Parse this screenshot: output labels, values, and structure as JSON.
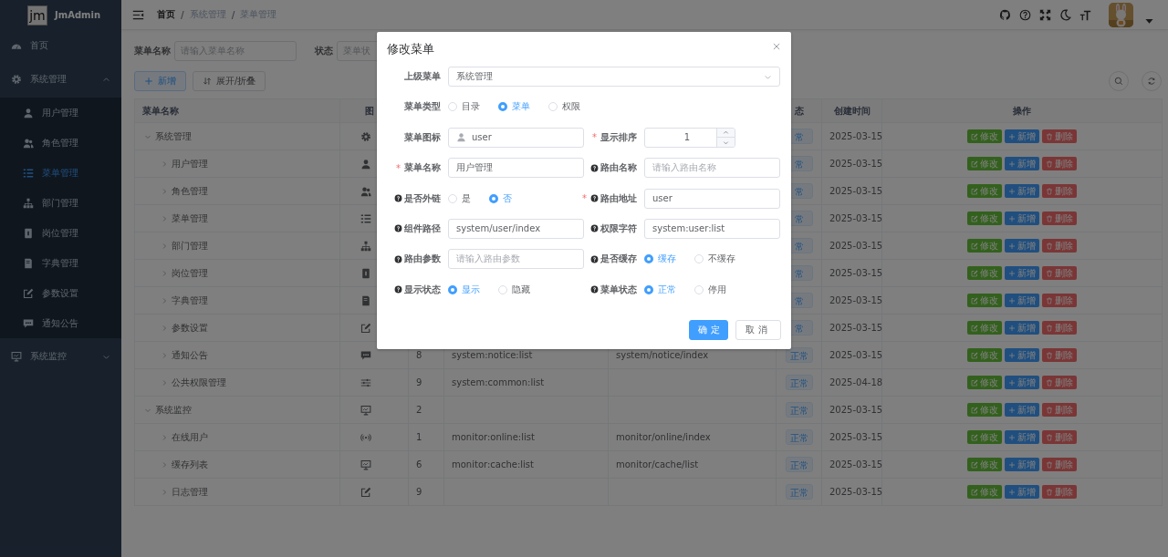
{
  "sidebar": {
    "brand": {
      "logo_text": "jm",
      "title": "JmAdmin"
    },
    "items": [
      {
        "kind": "link",
        "label": "首页",
        "selected": false
      },
      {
        "kind": "group",
        "label": "系统管理",
        "selected": false,
        "expanded": true,
        "children": [
          {
            "label": "用户管理",
            "selected": false
          },
          {
            "label": "角色管理",
            "selected": false
          },
          {
            "label": "菜单管理",
            "selected": true
          },
          {
            "label": "部门管理",
            "selected": false
          },
          {
            "label": "岗位管理",
            "selected": false
          },
          {
            "label": "字典管理",
            "selected": false
          },
          {
            "label": "参数设置",
            "selected": false
          },
          {
            "label": "通知公告",
            "selected": false
          }
        ]
      },
      {
        "kind": "group",
        "label": "系统监控",
        "selected": false,
        "expanded": false
      }
    ]
  },
  "header": {
    "breadcrumb": [
      {
        "kind": "link",
        "text": "首页"
      },
      {
        "kind": "separator",
        "text": "/"
      },
      {
        "kind": "text",
        "text": "系统管理"
      },
      {
        "kind": "separator",
        "text": "/"
      },
      {
        "kind": "text",
        "text": "菜单管理"
      }
    ]
  },
  "search_form": {
    "fields": [
      {
        "label": "菜单名称",
        "placeholder": "请输入菜单名称"
      },
      {
        "label": "状态",
        "placeholder": "菜单状"
      }
    ]
  },
  "toolbar": {
    "buttons": [
      {
        "kind": "primary",
        "label": "新增"
      },
      {
        "kind": "default",
        "label": "展开/折叠"
      }
    ]
  },
  "table": {
    "columns": {
      "menu_name": "菜单名称",
      "icon": "图",
      "status": "态",
      "created": "创建时间",
      "actions": "操作"
    },
    "rows": [
      {
        "name": "系统管理",
        "expanded": true,
        "status": "常",
        "created": "2025-03-15",
        "actions": [
          {
            "kind": "edit",
            "label": "修改"
          },
          {
            "kind": "add",
            "label": "新增"
          },
          {
            "kind": "delete",
            "label": "删除"
          }
        ],
        "children": [
          {
            "name": "用户管理",
            "expanded": false,
            "status": "常",
            "created": "2025-03-15",
            "actions": [
              {
                "kind": "edit",
                "label": "修改"
              },
              {
                "kind": "add",
                "label": "新增"
              },
              {
                "kind": "delete",
                "label": "删除"
              }
            ]
          },
          {
            "name": "角色管理",
            "expanded": false,
            "status": "常",
            "created": "2025-03-15",
            "actions": [
              {
                "kind": "edit",
                "label": "修改"
              },
              {
                "kind": "add",
                "label": "新增"
              },
              {
                "kind": "delete",
                "label": "删除"
              }
            ]
          },
          {
            "name": "菜单管理",
            "expanded": false,
            "status": "常",
            "created": "2025-03-15",
            "actions": [
              {
                "kind": "edit",
                "label": "修改"
              },
              {
                "kind": "add",
                "label": "新增"
              },
              {
                "kind": "delete",
                "label": "删除"
              }
            ]
          },
          {
            "name": "部门管理",
            "expanded": false,
            "status": "常",
            "created": "2025-03-15",
            "actions": [
              {
                "kind": "edit",
                "label": "修改"
              },
              {
                "kind": "add",
                "label": "新增"
              },
              {
                "kind": "delete",
                "label": "删除"
              }
            ]
          },
          {
            "name": "岗位管理",
            "expanded": false,
            "status": "常",
            "created": "2025-03-15",
            "actions": [
              {
                "kind": "edit",
                "label": "修改"
              },
              {
                "kind": "add",
                "label": "新增"
              },
              {
                "kind": "delete",
                "label": "删除"
              }
            ]
          },
          {
            "name": "字典管理",
            "expanded": false,
            "status": "常",
            "created": "2025-03-15",
            "actions": [
              {
                "kind": "edit",
                "label": "修改"
              },
              {
                "kind": "add",
                "label": "新增"
              },
              {
                "kind": "delete",
                "label": "删除"
              }
            ]
          },
          {
            "name": "参数设置",
            "expanded": false,
            "status": "常",
            "created": "2025-03-15",
            "actions": [
              {
                "kind": "edit",
                "label": "修改"
              },
              {
                "kind": "add",
                "label": "新增"
              },
              {
                "kind": "delete",
                "label": "删除"
              }
            ]
          },
          {
            "name": "通知公告",
            "expanded": false,
            "order": "8",
            "perms": "system:notice:list",
            "component": "system/notice/index",
            "status": "正常",
            "created": "2025-03-15",
            "actions": [
              {
                "kind": "edit",
                "label": "修改"
              },
              {
                "kind": "add",
                "label": "新增"
              },
              {
                "kind": "delete",
                "label": "删除"
              }
            ]
          },
          {
            "name": "公共权限管理",
            "expanded": false,
            "order": "9",
            "perms": "system:common:list",
            "status": "正常",
            "created": "2025-04-18",
            "actions": [
              {
                "kind": "edit",
                "label": "修改"
              },
              {
                "kind": "add",
                "label": "新增"
              },
              {
                "kind": "delete",
                "label": "删除"
              }
            ]
          }
        ]
      },
      {
        "name": "系统监控",
        "expanded": true,
        "order": "2",
        "status": "正常",
        "created": "2025-03-15",
        "actions": [
          {
            "kind": "edit",
            "label": "修改"
          },
          {
            "kind": "add",
            "label": "新增"
          },
          {
            "kind": "delete",
            "label": "删除"
          }
        ],
        "children": [
          {
            "name": "在线用户",
            "expanded": false,
            "order": "1",
            "perms": "monitor:online:list",
            "component": "monitor/online/index",
            "status": "正常",
            "created": "2025-03-15",
            "actions": [
              {
                "kind": "edit",
                "label": "修改"
              },
              {
                "kind": "add",
                "label": "新增"
              },
              {
                "kind": "delete",
                "label": "删除"
              }
            ]
          },
          {
            "name": "缓存列表",
            "expanded": false,
            "order": "6",
            "perms": "monitor:cache:list",
            "component": "monitor/cache/list",
            "status": "正常",
            "created": "2025-03-15",
            "actions": [
              {
                "kind": "edit",
                "label": "修改"
              },
              {
                "kind": "add",
                "label": "新增"
              },
              {
                "kind": "delete",
                "label": "删除"
              }
            ]
          },
          {
            "name": "日志管理",
            "expanded": false,
            "order": "9",
            "status": "正常",
            "created": "2025-03-15",
            "actions": [
              {
                "kind": "edit",
                "label": "修改"
              },
              {
                "kind": "add",
                "label": "新增"
              },
              {
                "kind": "delete",
                "label": "删除"
              }
            ]
          }
        ]
      }
    ]
  },
  "dialog": {
    "title": "修改菜单",
    "rows": [
      [
        {
          "kind": "select",
          "label": "上级菜单",
          "value": "系统管理"
        }
      ],
      [
        {
          "kind": "radio",
          "label": "菜单类型",
          "options": [
            {
              "label": "目录",
              "selected": false
            },
            {
              "label": "菜单",
              "selected": true
            },
            {
              "label": "权限",
              "selected": false
            }
          ]
        }
      ],
      [
        {
          "kind": "icon_input",
          "label": "菜单图标",
          "value": "user"
        },
        {
          "kind": "number",
          "label": "显示排序",
          "required_mark": "*",
          "value": "1"
        }
      ],
      [
        {
          "kind": "input",
          "label": "菜单名称",
          "required_mark": "*",
          "value": "用户管理"
        },
        {
          "kind": "input",
          "label": "路由名称",
          "help": true,
          "placeholder": "请输入路由名称"
        }
      ],
      [
        {
          "kind": "radio",
          "label": "是否外链",
          "help": true,
          "options": [
            {
              "label": "是",
              "selected": false
            },
            {
              "label": "否",
              "selected": true
            }
          ]
        },
        {
          "kind": "input",
          "label": "路由地址",
          "help": true,
          "required_mark": "*",
          "value": "user"
        }
      ],
      [
        {
          "kind": "input",
          "label": "组件路径",
          "help": true,
          "value": "system/user/index"
        },
        {
          "kind": "input",
          "label": "权限字符",
          "help": true,
          "value": "system:user:list"
        }
      ],
      [
        {
          "kind": "input",
          "label": "路由参数",
          "help": true,
          "placeholder": "请输入路由参数"
        },
        {
          "kind": "radio",
          "label": "是否缓存",
          "help": true,
          "options": [
            {
              "label": "缓存",
              "selected": true
            },
            {
              "label": "不缓存",
              "selected": false
            }
          ]
        }
      ],
      [
        {
          "kind": "radio",
          "label": "显示状态",
          "help": true,
          "options": [
            {
              "label": "显示",
              "selected": true
            },
            {
              "label": "隐藏",
              "selected": false
            }
          ]
        },
        {
          "kind": "radio",
          "label": "菜单状态",
          "help": true,
          "options": [
            {
              "label": "正常",
              "selected": true
            },
            {
              "label": "停用",
              "selected": false
            }
          ]
        }
      ]
    ],
    "buttons": [
      {
        "kind": "primary",
        "label": "确定"
      },
      {
        "kind": "default",
        "label": "取消"
      }
    ]
  }
}
